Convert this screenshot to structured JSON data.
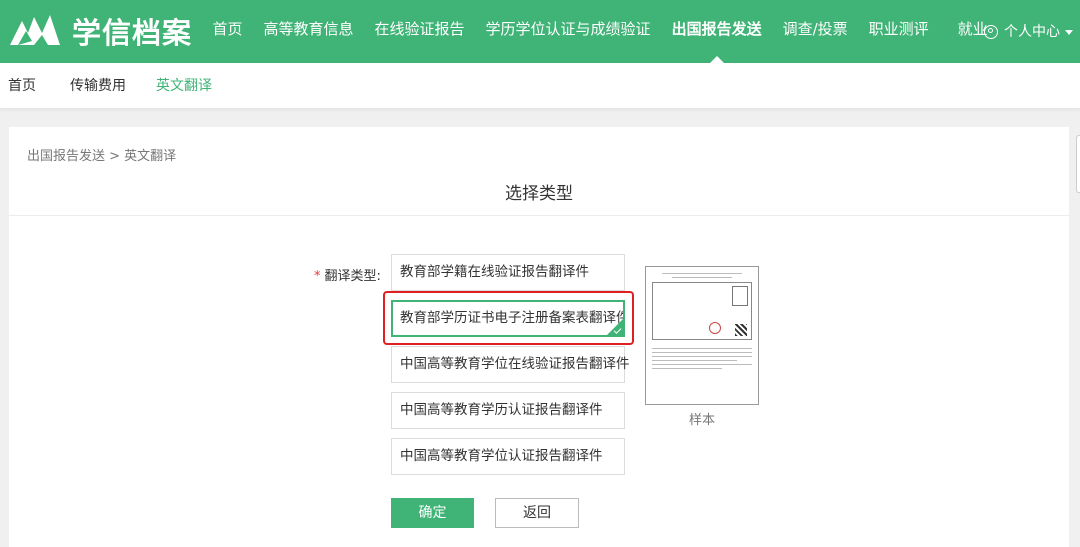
{
  "header": {
    "logo_text": "学信档案",
    "nav": [
      {
        "label": "首页",
        "active": false
      },
      {
        "label": "高等教育信息",
        "active": false
      },
      {
        "label": "在线验证报告",
        "active": false
      },
      {
        "label": "学历学位认证与成绩验证",
        "active": false
      },
      {
        "label": "出国报告发送",
        "active": true
      },
      {
        "label": "调查/投票",
        "active": false
      },
      {
        "label": "职业测评",
        "active": false
      },
      {
        "label": "就业",
        "active": false
      }
    ],
    "user_center_label": "个人中心"
  },
  "subnav": {
    "items": [
      {
        "label": "首页",
        "active": false
      },
      {
        "label": "传输费用",
        "active": false
      },
      {
        "label": "英文翻译",
        "active": true
      }
    ]
  },
  "main": {
    "breadcrumb": "出国报告发送 > 英文翻译",
    "title": "选择类型",
    "form_label": "翻译类型:",
    "required_mark": "*",
    "options": [
      {
        "label": "教育部学籍在线验证报告翻译件",
        "selected": false
      },
      {
        "label": "教育部学历证书电子注册备案表翻译件",
        "selected": true
      },
      {
        "label": "中国高等教育学位在线验证报告翻译件",
        "selected": false
      },
      {
        "label": "中国高等教育学历认证报告翻译件",
        "selected": false
      },
      {
        "label": "中国高等教育学位认证报告翻译件",
        "selected": false
      }
    ],
    "sample_caption": "样本",
    "confirm_label": "确定",
    "back_label": "返回"
  },
  "colors": {
    "brand_green": "#40b377",
    "highlight_red": "#e02020"
  }
}
